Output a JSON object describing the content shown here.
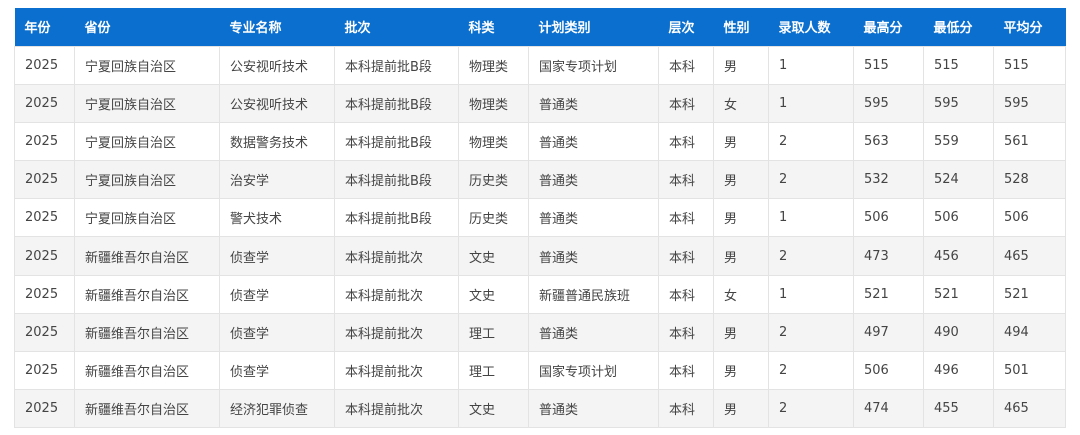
{
  "table": {
    "headers": [
      "年份",
      "省份",
      "专业名称",
      "批次",
      "科类",
      "计划类别",
      "层次",
      "性别",
      "录取人数",
      "最高分",
      "最低分",
      "平均分"
    ],
    "rows": [
      [
        "2025",
        "宁夏回族自治区",
        "公安视听技术",
        "本科提前批B段",
        "物理类",
        "国家专项计划",
        "本科",
        "男",
        "1",
        "515",
        "515",
        "515"
      ],
      [
        "2025",
        "宁夏回族自治区",
        "公安视听技术",
        "本科提前批B段",
        "物理类",
        "普通类",
        "本科",
        "女",
        "1",
        "595",
        "595",
        "595"
      ],
      [
        "2025",
        "宁夏回族自治区",
        "数据警务技术",
        "本科提前批B段",
        "物理类",
        "普通类",
        "本科",
        "男",
        "2",
        "563",
        "559",
        "561"
      ],
      [
        "2025",
        "宁夏回族自治区",
        "治安学",
        "本科提前批B段",
        "历史类",
        "普通类",
        "本科",
        "男",
        "2",
        "532",
        "524",
        "528"
      ],
      [
        "2025",
        "宁夏回族自治区",
        "警犬技术",
        "本科提前批B段",
        "历史类",
        "普通类",
        "本科",
        "男",
        "1",
        "506",
        "506",
        "506"
      ],
      [
        "2025",
        "新疆维吾尔自治区",
        "侦查学",
        "本科提前批次",
        "文史",
        "普通类",
        "本科",
        "男",
        "2",
        "473",
        "456",
        "465"
      ],
      [
        "2025",
        "新疆维吾尔自治区",
        "侦查学",
        "本科提前批次",
        "文史",
        "新疆普通民族班",
        "本科",
        "女",
        "1",
        "521",
        "521",
        "521"
      ],
      [
        "2025",
        "新疆维吾尔自治区",
        "侦查学",
        "本科提前批次",
        "理工",
        "普通类",
        "本科",
        "男",
        "2",
        "497",
        "490",
        "494"
      ],
      [
        "2025",
        "新疆维吾尔自治区",
        "侦查学",
        "本科提前批次",
        "理工",
        "国家专项计划",
        "本科",
        "男",
        "2",
        "506",
        "496",
        "501"
      ],
      [
        "2025",
        "新疆维吾尔自治区",
        "经济犯罪侦查",
        "本科提前批次",
        "文史",
        "普通类",
        "本科",
        "男",
        "2",
        "474",
        "455",
        "465"
      ]
    ]
  },
  "colors": {
    "header_bg": "#0b6fcf",
    "header_text": "#ffffff",
    "row_alt_bg": "#f4f4f4",
    "border": "#e3e3e3"
  }
}
